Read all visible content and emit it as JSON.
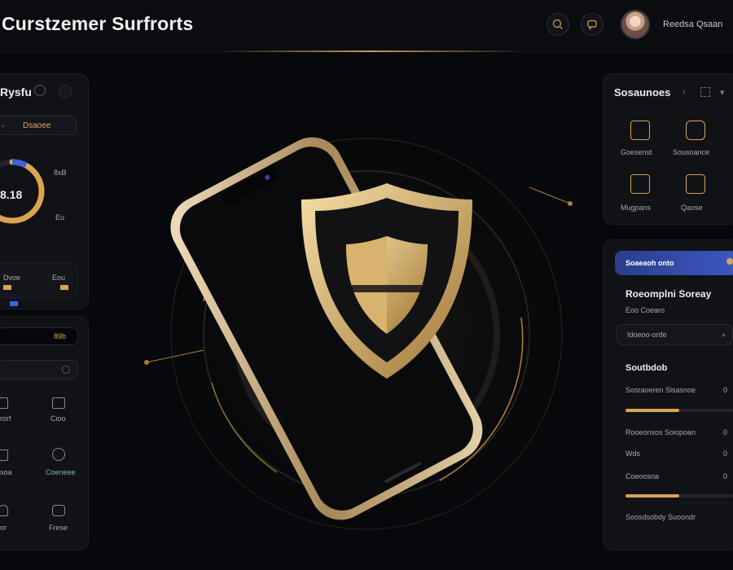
{
  "header": {
    "title": "Curstzemer Surfrorts",
    "user_name": "Reedsa Qsaan",
    "search_icon": "search-icon",
    "chat_icon": "chat-icon",
    "colors": {
      "accent": "#d8a85a",
      "brand_blue": "#3d57c2",
      "background": "#07080b"
    }
  },
  "left_panel": {
    "title": "Rysfu",
    "status_label": "Dsaoee",
    "gauge_value": "8.18",
    "gauge_label_top": "8xB",
    "gauge_label_bottom": "Eu",
    "progress": 0.62,
    "legend_a": "Dvoe",
    "legend_b": "Eou"
  },
  "left_bottom_panel": {
    "tag": "89b",
    "items": [
      {
        "label": "rorf",
        "icon": "doc-icon"
      },
      {
        "label": "Cioo",
        "icon": "card-icon"
      },
      {
        "label": "soa",
        "icon": "box-icon"
      },
      {
        "label": "Coeneee",
        "icon": "clock-icon"
      },
      {
        "label": "or",
        "icon": "shield-icon"
      },
      {
        "label": "Frese",
        "icon": "lock-icon"
      }
    ]
  },
  "right_top_panel": {
    "title": "Sosaunoes",
    "tiles": [
      {
        "label": "Goesenst",
        "icon": "bag-icon"
      },
      {
        "label": "Sousoance",
        "icon": "message-icon"
      },
      {
        "label": "Mugpans",
        "icon": "ticket-icon"
      },
      {
        "label": "Qaose",
        "icon": "chart-icon"
      }
    ]
  },
  "right_bottom_panel": {
    "button_label": "Soaeaoh onto",
    "heading": "Roeomplni Soreay",
    "subheading": "Eoo Coearo",
    "search_placeholder": "Idoeoo-orde",
    "section_title": "Soutbdob",
    "rows": [
      {
        "label": "Sosraoeren Sisasnoe",
        "value": "0",
        "progress": 0.5
      },
      {
        "label": "Rooeonsos Soiopoan",
        "value": "0",
        "progress": null
      },
      {
        "label": "Wds",
        "value": "0",
        "progress": null
      },
      {
        "label": "Coeoosna",
        "value": "0",
        "progress": 0.5
      }
    ],
    "footer": "Soosdsobdy Suoondr"
  }
}
